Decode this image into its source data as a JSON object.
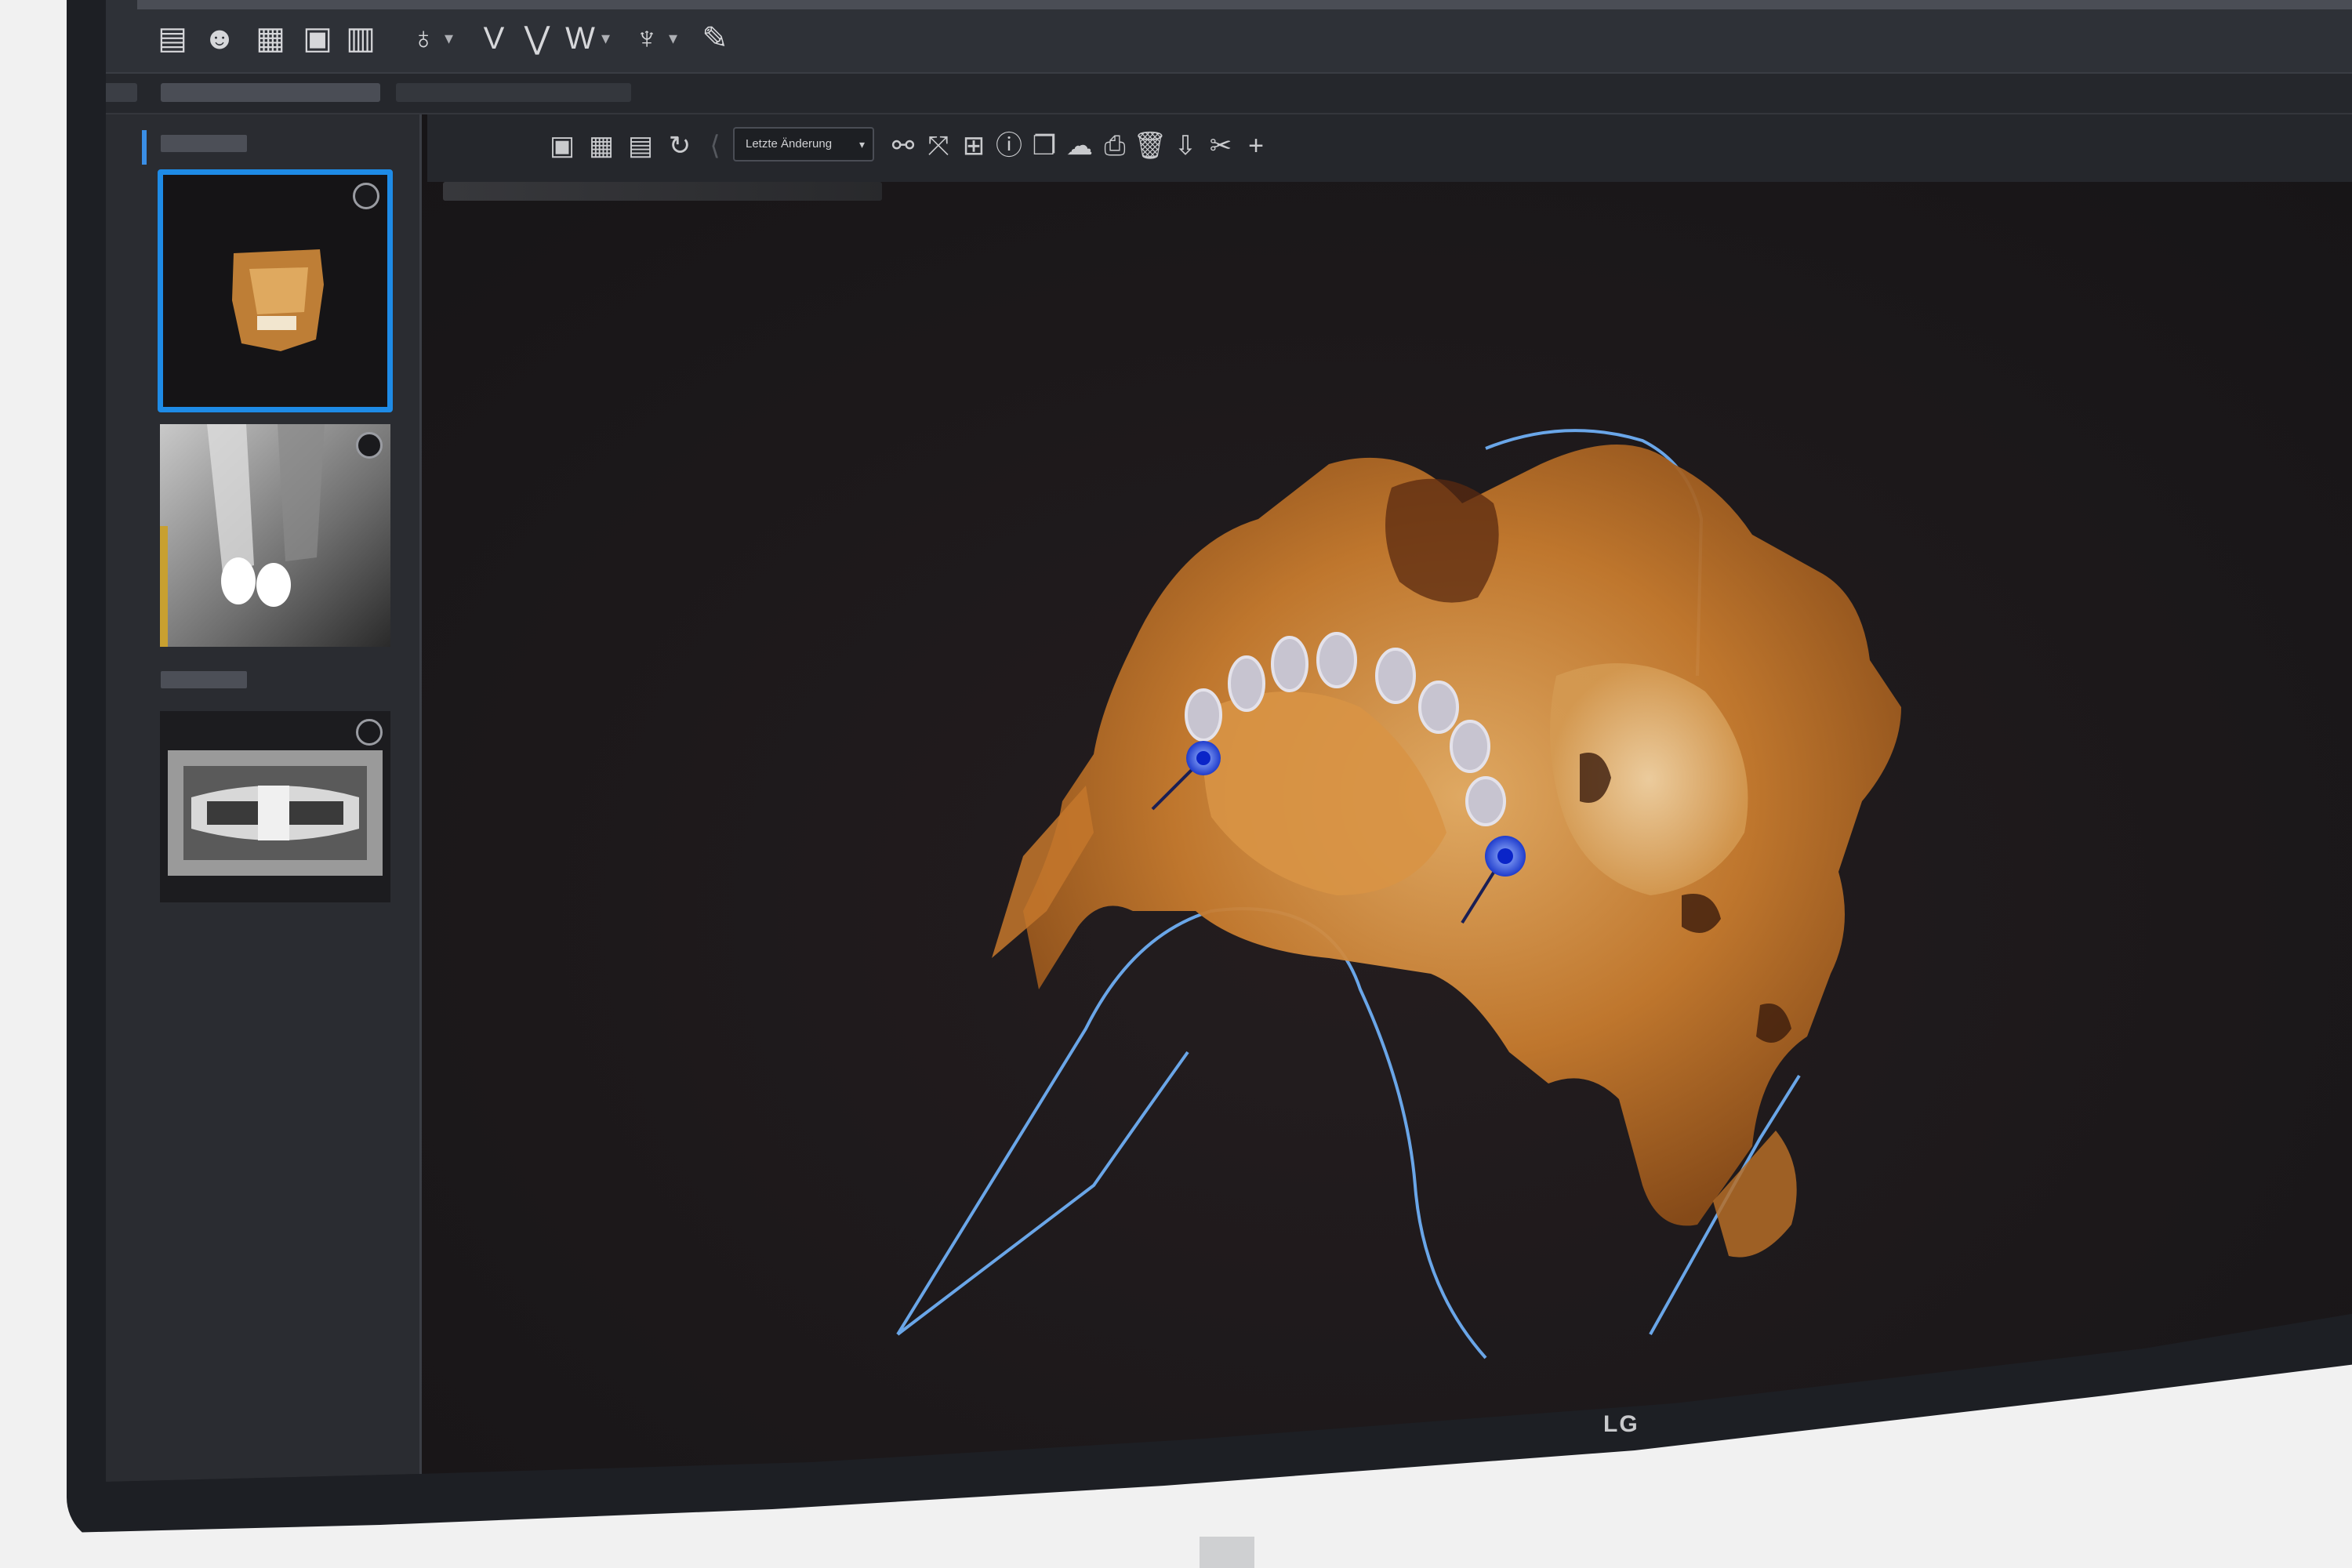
{
  "app": {
    "dropdown": {
      "label": "Letzte Änderung"
    },
    "monitor_brand": "LG"
  },
  "colors": {
    "accent": "#1e8be6",
    "bone": "#c8782a",
    "guide_curve": "#6aa6e8",
    "implant": "#2b5cff"
  },
  "icons": {
    "top_toolbar": [
      "patient-record-icon",
      "patients-icon",
      "calendar-icon",
      "clipboard-icon",
      "documents-icon",
      "tooth-icon",
      "upper-jaw-icon",
      "lower-jaw-icon",
      "full-arch-icon",
      "implant-icon",
      "pen-icon"
    ],
    "main_toolbar": [
      "layout-single-icon",
      "layout-grid-icon",
      "layout-strip-icon",
      "rotate-icon",
      "back-icon",
      "link-icon",
      "zoom-fit-icon",
      "measure-icon",
      "info-icon",
      "copy-icon",
      "cloud-icon",
      "print-icon",
      "trash-icon",
      "export-icon",
      "attach-icon",
      "add-icon"
    ]
  },
  "thumbnails": [
    {
      "type": "3d-volume",
      "selected": true
    },
    {
      "type": "intraoral-xray",
      "selected": false
    },
    {
      "type": "panoramic",
      "selected": false
    }
  ]
}
